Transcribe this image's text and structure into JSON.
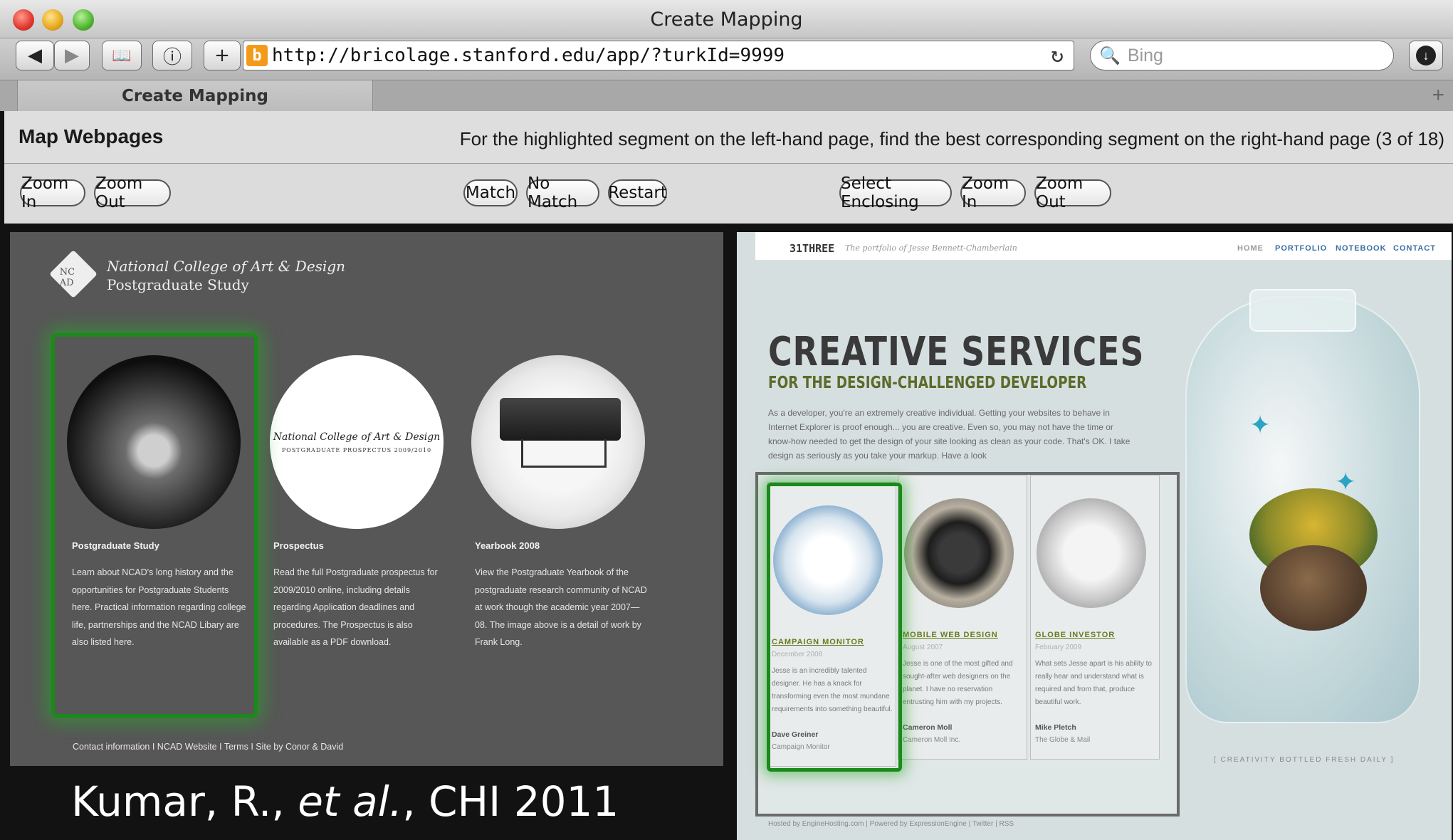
{
  "window": {
    "title": "Create Mapping"
  },
  "toolbar": {
    "back_icon": "◀",
    "forward_icon": "▶",
    "bookmarks_icon": "📖",
    "info_icon": "ⓘ",
    "add_icon": "+",
    "url": "http://bricolage.stanford.edu/app/?turkId=9999",
    "favicon_glyph": "b",
    "reload_icon": "↻",
    "search_placeholder": "Bing",
    "search_icon": "🔍",
    "download_icon": "↓"
  },
  "tab": {
    "label": "Create Mapping",
    "new_tab_icon": "+"
  },
  "app": {
    "title": "Map Webpages",
    "instructions": "For the highlighted segment on the left-hand page, find the best corresponding segment on the right-hand page (3 of 18)",
    "left_controls": [
      "Zoom In",
      "Zoom Out"
    ],
    "center_controls": [
      "Match",
      "No Match",
      "Restart"
    ],
    "right_controls": [
      "Select Enclosing",
      "Zoom In",
      "Zoom Out"
    ]
  },
  "left_page": {
    "logo_text": "NC AD",
    "brand_name": "National College of Art & Design",
    "brand_sub": "Postgraduate Study",
    "prospectus_title": "National College of Art & Design",
    "prospectus_sub": "POSTGRADUATE PROSPECTUS 2009/2010",
    "columns": [
      {
        "heading": "Postgraduate Study",
        "text": "Learn about NCAD's long history and the opportunities for Postgraduate Students here. Practical information regarding college life, partnerships and the NCAD Libary are also listed here."
      },
      {
        "heading": "Prospectus",
        "text": "Read the full Postgraduate prospectus for 2009/2010 online, including details regarding Application deadlines and procedures. The Prospectus is also available as a PDF download."
      },
      {
        "heading": "Yearbook 2008",
        "text": "View the Postgraduate Yearbook of the postgraduate research community of NCAD at work though the academic year 2007—08. The image above is a detail of work by Frank Long."
      }
    ],
    "footer": "Contact information I NCAD Website I Terms I Site by Conor & David"
  },
  "caption": {
    "prefix": "Kumar, R., ",
    "italic": "et al.",
    "suffix": ", CHI 2011"
  },
  "right_page": {
    "brand": "31THREE",
    "tagline": "The portfolio of Jesse Bennett-Chamberlain",
    "nav": [
      "HOME",
      "PORTFOLIO",
      "NOTEBOOK",
      "CONTACT"
    ],
    "heading": "CREATIVE SERVICES",
    "subheading": "FOR THE DESIGN-CHALLENGED DEVELOPER",
    "intro": "As a developer, you're an extremely creative individual. Getting your websites to behave in Internet Explorer is proof enough... you are creative. Even so, you may not have the time or know-how needed to get the design of your site looking as clean as your code. That's OK. I take design as seriously as you take your markup. Have a look",
    "cards": [
      {
        "title": "CAMPAIGN MONITOR",
        "date": "December 2008",
        "text": "Jesse is an incredibly talented designer. He has a knack for transforming even the most mundane requirements into something beautiful.",
        "author": "Dave Greiner",
        "org": "Campaign Monitor"
      },
      {
        "title": "MOBILE WEB DESIGN",
        "date": "August 2007",
        "text": "Jesse is one of the most gifted and sought-after web designers on the planet. I have no reservation entrusting him with my projects.",
        "author": "Cameron Moll",
        "org": "Cameron Moll Inc."
      },
      {
        "title": "GLOBE INVESTOR",
        "date": "February 2009",
        "text": "What sets Jesse apart is his ability to really hear and understand what is required and from that, produce beautiful work.",
        "author": "Mike Pletch",
        "org": "The Globe & Mail"
      }
    ],
    "bottle_note": "[ CREATIVITY BOTTLED FRESH DAILY ]",
    "footer": "Hosted by EngineHosting.com  |  Powered by ExpressionEngine  |  Twitter  |  RSS"
  },
  "colors": {
    "highlight": "#1a8a1a",
    "butterfly": "#2aa3c4",
    "card_title": "#6b7a1f"
  }
}
